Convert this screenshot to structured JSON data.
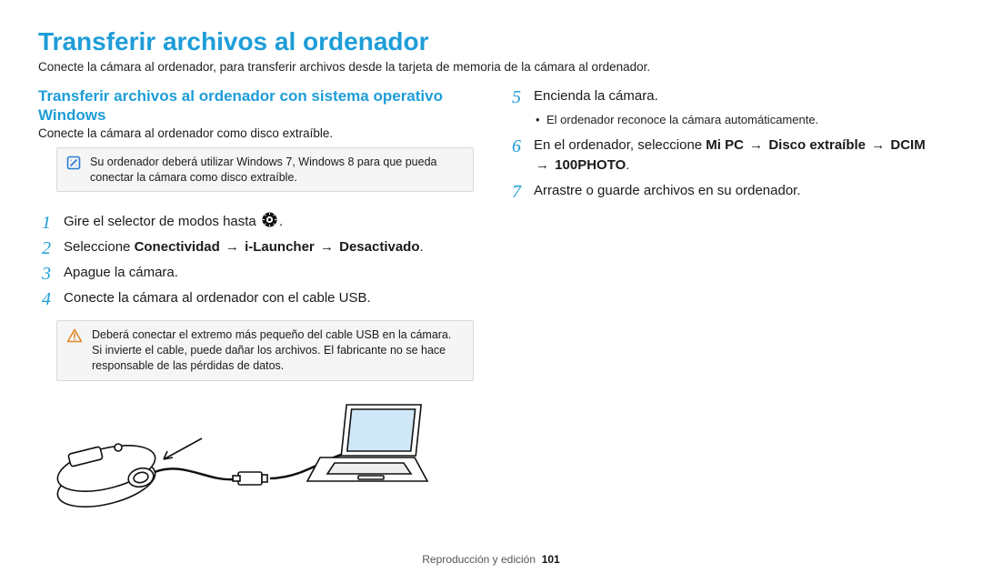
{
  "title": "Transferir archivos al ordenador",
  "intro": "Conecte la cámara al ordenador, para transferir archivos desde la tarjeta de memoria de la cámara al ordenador.",
  "left": {
    "section_title": "Transferir archivos al ordenador con sistema operativo Windows",
    "section_sub": "Conecte la cámara al ordenador como disco extraíble.",
    "note_info": "Su ordenador deberá utilizar Windows 7, Windows 8 para que pueda conectar la cámara como disco extraíble.",
    "steps": {
      "s1_a": "Gire el selector de modos hasta ",
      "s1_b": ".",
      "s2_a": "Seleccione ",
      "s2_b": "Conectividad",
      "s2_c": "i-Launcher",
      "s2_d": "Desactivado",
      "s2_e": ".",
      "s3": "Apague la cámara.",
      "s4": "Conecte la cámara al ordenador con el cable USB."
    },
    "warn": "Deberá conectar el extremo más pequeño del cable USB en la cámara. Si invierte el cable, puede dañar los archivos. El fabricante no se hace responsable de las pérdidas de datos."
  },
  "right": {
    "s5": "Encienda la cámara.",
    "s5_sub": "El ordenador reconoce la cámara automáticamente.",
    "s6_a": "En el ordenador, seleccione ",
    "s6_b": "Mi PC",
    "s6_c": "Disco extraíble",
    "s6_d": "DCIM",
    "s6_e": "100PHOTO",
    "s6_f": ".",
    "s7": "Arrastre o guarde archivos en su ordenador."
  },
  "arrow": "→",
  "footer_section": "Reproducción y edición",
  "footer_page": "101"
}
